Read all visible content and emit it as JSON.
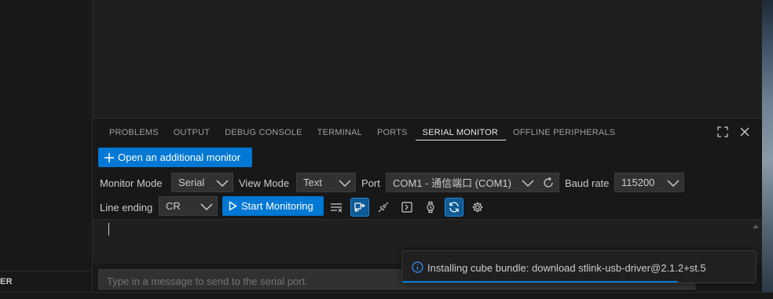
{
  "sidebar": {
    "partial_label": "ER"
  },
  "panel": {
    "tabs": [
      {
        "label": "PROBLEMS",
        "active": false
      },
      {
        "label": "OUTPUT",
        "active": false
      },
      {
        "label": "DEBUG CONSOLE",
        "active": false
      },
      {
        "label": "TERMINAL",
        "active": false
      },
      {
        "label": "PORTS",
        "active": false
      },
      {
        "label": "SERIAL MONITOR",
        "active": true
      },
      {
        "label": "OFFLINE PERIPHERALS",
        "active": false
      }
    ]
  },
  "serial": {
    "open_monitor_label": "Open an additional monitor",
    "monitor_mode_label": "Monitor Mode",
    "monitor_mode_value": "Serial",
    "view_mode_label": "View Mode",
    "view_mode_value": "Text",
    "port_label": "Port",
    "port_value": "COM1 - 通信端口 (COM1)",
    "baud_label": "Baud rate",
    "baud_value": "115200",
    "line_ending_label": "Line ending",
    "line_ending_value": "CR",
    "start_label": "Start Monitoring",
    "input_placeholder": "Type in a message to send to the serial port."
  },
  "toast": {
    "message": "Installing cube bundle: download stlink-usb-driver@2.1.2+st.5",
    "progress": 0.78
  },
  "colors": {
    "accent": "#0078d4",
    "panel_bg": "#181818",
    "editor_bg": "#1f1f1f"
  }
}
